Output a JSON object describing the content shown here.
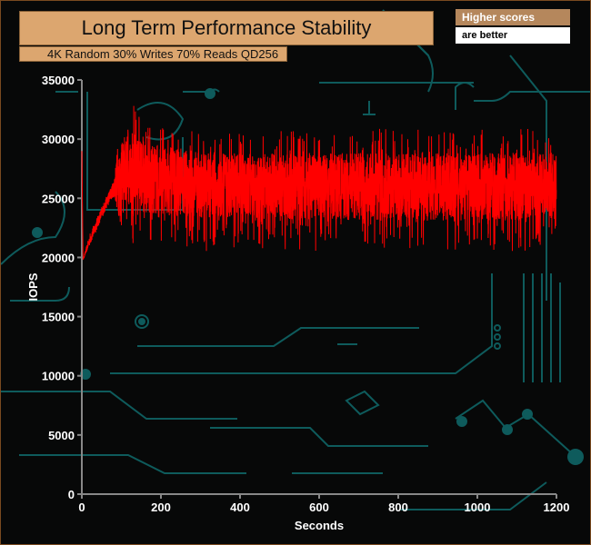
{
  "header": {
    "badge_line1": "Higher scores",
    "badge_line2": "are better"
  },
  "colors": {
    "series": "#ff0000",
    "accent": "#dca66f",
    "circuit": "#0e5b5c",
    "axis": "#888888"
  },
  "chart_data": {
    "type": "line",
    "title": "Long Term Performance Stability",
    "subtitle": "4K Random 30% Writes 70% Reads QD256",
    "xlabel": "Seconds",
    "ylabel": "IOPS",
    "xlim": [
      0,
      1200
    ],
    "ylim": [
      0,
      35000
    ],
    "xticks": [
      "0",
      "200",
      "400",
      "600",
      "800",
      "1000",
      "1200"
    ],
    "yticks": [
      "0",
      "5000",
      "10000",
      "15000",
      "20000",
      "25000",
      "30000",
      "35000"
    ],
    "grid": false,
    "legend": "none",
    "series": [
      {
        "name": "IOPS",
        "x": [
          0,
          3,
          20,
          40,
          60,
          80,
          95,
          110,
          125,
          150,
          200,
          300,
          400,
          500,
          600,
          700,
          800,
          900,
          1000,
          1100,
          1200
        ],
        "min": [
          29000,
          19800,
          21000,
          22500,
          24000,
          25200,
          23000,
          21500,
          21000,
          20500,
          20500,
          20500,
          20800,
          20600,
          20500,
          20500,
          20600,
          20500,
          20600,
          20500,
          20500
        ],
        "mean": [
          29000,
          19800,
          21500,
          23000,
          24500,
          25800,
          27000,
          27500,
          27500,
          27000,
          26500,
          26200,
          26000,
          26000,
          26000,
          26000,
          26000,
          26000,
          26000,
          26000,
          26000
        ],
        "max": [
          29000,
          19800,
          22000,
          23500,
          25000,
          26500,
          30500,
          32500,
          33300,
          32000,
          31000,
          30800,
          30500,
          30800,
          30500,
          30800,
          31000,
          30800,
          30800,
          31000,
          30500
        ]
      }
    ]
  }
}
